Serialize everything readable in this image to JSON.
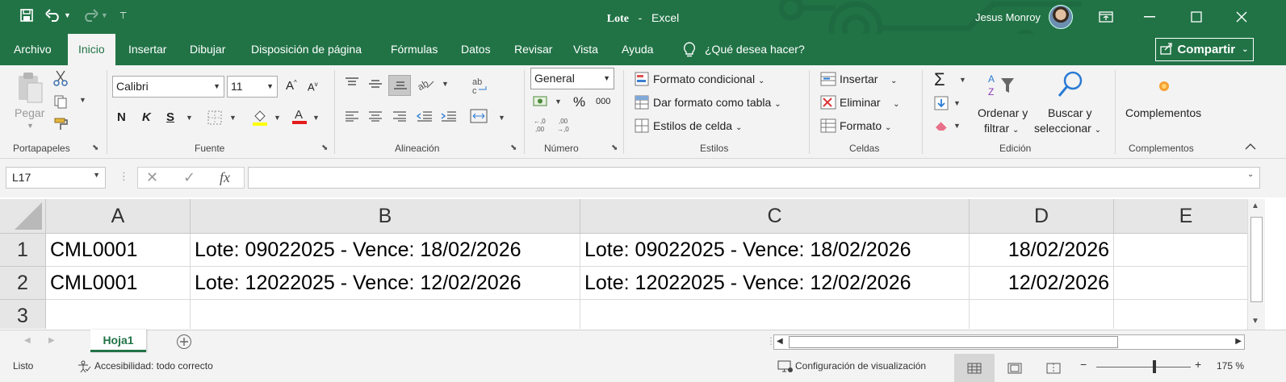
{
  "window": {
    "title_file": "Lote",
    "title_sep": "-",
    "title_app": "Excel",
    "user": "Jesus Monroy"
  },
  "menu": {
    "tabs": [
      "Archivo",
      "Inicio",
      "Insertar",
      "Dibujar",
      "Disposición de página",
      "Fórmulas",
      "Datos",
      "Revisar",
      "Vista",
      "Ayuda"
    ],
    "tell_me": "¿Qué desea hacer?",
    "share": "Compartir"
  },
  "ribbon": {
    "clipboard": {
      "paste": "Pegar",
      "label": "Portapapeles"
    },
    "font": {
      "name": "Calibri",
      "size": "11",
      "label": "Fuente",
      "bold": "N",
      "italic": "K",
      "underline": "S"
    },
    "alignment": {
      "label": "Alineación"
    },
    "number": {
      "format": "General",
      "percent": "%",
      "thousands": "000",
      "label": "Número"
    },
    "styles": {
      "conditional": "Formato condicional",
      "as_table": "Dar formato como tabla",
      "cell_styles": "Estilos de celda",
      "label": "Estilos"
    },
    "cells": {
      "insert": "Insertar",
      "delete": "Eliminar",
      "format": "Formato",
      "label": "Celdas"
    },
    "editing": {
      "sort_1": "Ordenar y",
      "sort_2": "filtrar",
      "find_1": "Buscar y",
      "find_2": "seleccionar",
      "label": "Edición"
    },
    "addins": {
      "button": "Complementos",
      "label": "Complementos"
    }
  },
  "formula_bar": {
    "name_box": "L17",
    "fx": "fx",
    "value": ""
  },
  "grid": {
    "columns": [
      "A",
      "B",
      "C",
      "D",
      "E"
    ],
    "rows": [
      {
        "n": "1",
        "A": "CML0001",
        "B": "Lote: 09022025 - Vence: 18/02/2026",
        "C": "Lote: 09022025 - Vence: 18/02/2026",
        "D": "18/02/2026",
        "E": ""
      },
      {
        "n": "2",
        "A": "CML0001",
        "B": "Lote: 12022025 - Vence: 12/02/2026",
        "C": "Lote: 12022025 - Vence: 12/02/2026",
        "D": "12/02/2026",
        "E": ""
      },
      {
        "n": "3",
        "A": "",
        "B": "",
        "C": "",
        "D": "",
        "E": ""
      }
    ]
  },
  "sheets": {
    "active": "Hoja1"
  },
  "status": {
    "ready": "Listo",
    "accessibility": "Accesibilidad: todo correcto",
    "display_settings": "Configuración de visualización",
    "zoom_minus": "−",
    "zoom_plus": "+",
    "zoom": "175 %"
  },
  "colors": {
    "brand": "#217346",
    "ribbon_bg": "#f3f3f3"
  },
  "icons": [
    "save-icon",
    "undo-icon",
    "redo-icon",
    "customize-qat-icon",
    "ribbon-display-icon",
    "minimize-icon",
    "maximize-icon",
    "close-icon",
    "lightbulb-icon",
    "share-icon",
    "paste-icon",
    "cut-icon",
    "copy-icon",
    "format-painter-icon",
    "borders-icon",
    "fill-color-icon",
    "font-color-icon",
    "autosum-icon",
    "sort-filter-icon",
    "find-icon",
    "addin-icon",
    "add-sheet-icon",
    "accessibility-icon",
    "display-settings-icon",
    "normal-view-icon",
    "page-layout-icon",
    "page-break-icon"
  ]
}
